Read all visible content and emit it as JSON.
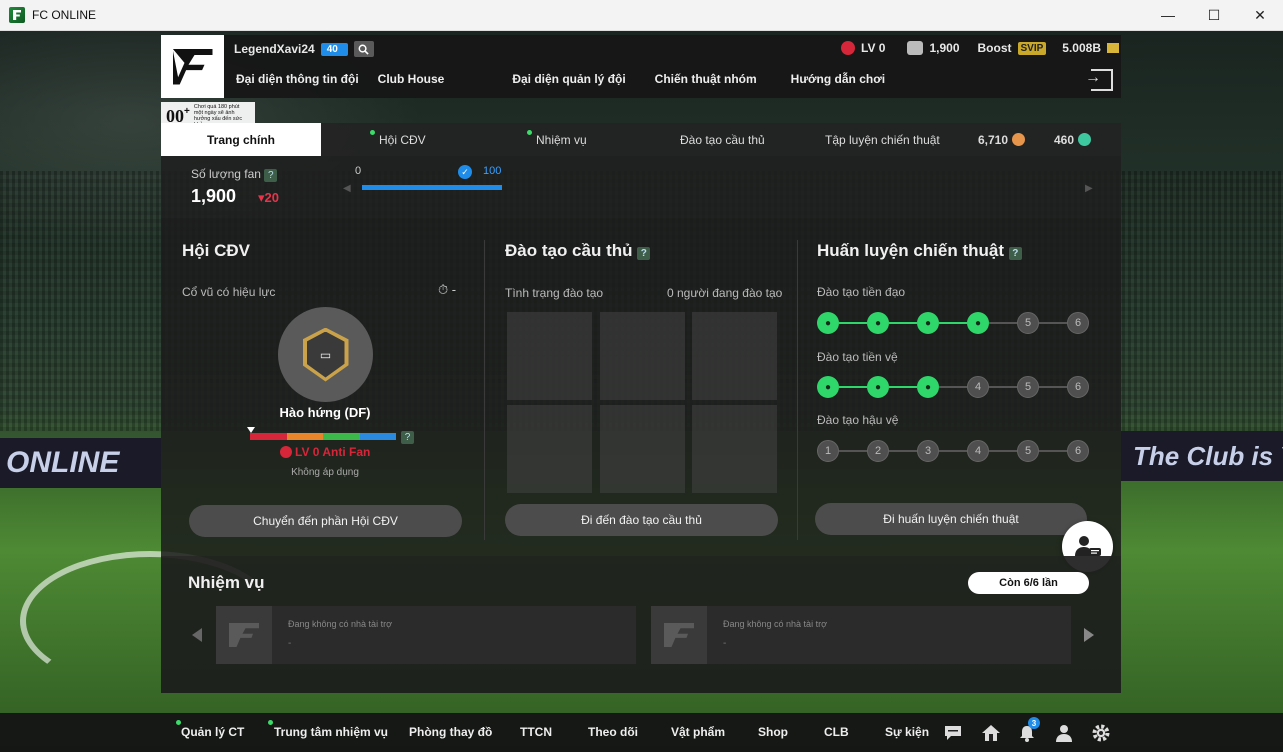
{
  "window": {
    "title": "FC ONLINE",
    "controls": [
      "—",
      "☐",
      "✕"
    ]
  },
  "adboards": [
    "ONLINE",
    "The Club",
    "The Club is Y"
  ],
  "header": {
    "username": "LegendXavi24",
    "level": "40",
    "nav": [
      "Đại diện thông tin đội",
      "Club House",
      "Đại diện quản lý đội",
      "Chiến thuật nhóm",
      "Hướng dẫn chơi"
    ],
    "lv": "LV 0",
    "fans": "1,900",
    "boost_label": "Boost",
    "svip": "SVIP",
    "balance": "5.008B"
  },
  "promo": {
    "big": "00",
    "plus": "+",
    "text": "Chơi quá 180 phút một ngày sẽ ảnh hưởng xấu đến sức khỏe"
  },
  "subtabs": {
    "main": "Trang chính",
    "fanclub": "Hội CĐV",
    "missions": "Nhiệm vụ",
    "training": "Đào tạo cầu thủ",
    "tactics": "Tập luyện chiến thuật",
    "coin1": "6,710",
    "coin2": "460"
  },
  "fanstrip": {
    "label": "Số lượng fan",
    "count": "1,900",
    "delta": "20",
    "bar_min": "0",
    "bar_max": "100",
    "bar_progress": 1.0
  },
  "fanclub": {
    "title": "Hội CĐV",
    "cheer_label": "Cổ vũ có hiệu lực",
    "cheer_value": "-",
    "badge_name": "Hào hứng (DF)",
    "lv_text": "LV 0 Anti Fan",
    "apply_text": "Không áp dụng",
    "button": "Chuyển đến phần Hội CĐV"
  },
  "training": {
    "title": "Đào tạo cầu thủ",
    "status_label": "Tình trạng đào tạo",
    "status_value": "0 người đang đào tạo",
    "button": "Đi đến đào tạo cầu thủ"
  },
  "tactics": {
    "title": "Huấn luyện chiến thuật",
    "rows": [
      {
        "label": "Đào tạo tiền đạo",
        "nodes": [
          "",
          "",
          "",
          "",
          "5",
          "6"
        ],
        "active": 4
      },
      {
        "label": "Đào tạo tiền vệ",
        "nodes": [
          "",
          "",
          "",
          "4",
          "5",
          "6"
        ],
        "active": 3
      },
      {
        "label": "Đào tạo hậu vệ",
        "nodes": [
          "1",
          "2",
          "3",
          "4",
          "5",
          "6"
        ],
        "active": 0
      }
    ],
    "button": "Đi huấn luyện chiến thuật"
  },
  "missions": {
    "title": "Nhiệm vụ",
    "remaining": "Còn 6/6 lần",
    "cards": [
      {
        "text": "Đang không có nhà tài trợ",
        "sub": "-"
      },
      {
        "text": "Đang không có nhà tài trợ",
        "sub": "-"
      }
    ]
  },
  "bottomnav": {
    "items": [
      "Quản lý CT",
      "Trung tâm nhiệm vụ",
      "Phòng thay đồ",
      "TTCN",
      "Theo dõi",
      "Vật phẩm",
      "Shop",
      "CLB",
      "Sự kiện"
    ],
    "notifications": "3"
  },
  "colors": {
    "accent_green": "#2fd66a",
    "accent_blue": "#1e8ce8",
    "red": "#d6263a"
  }
}
